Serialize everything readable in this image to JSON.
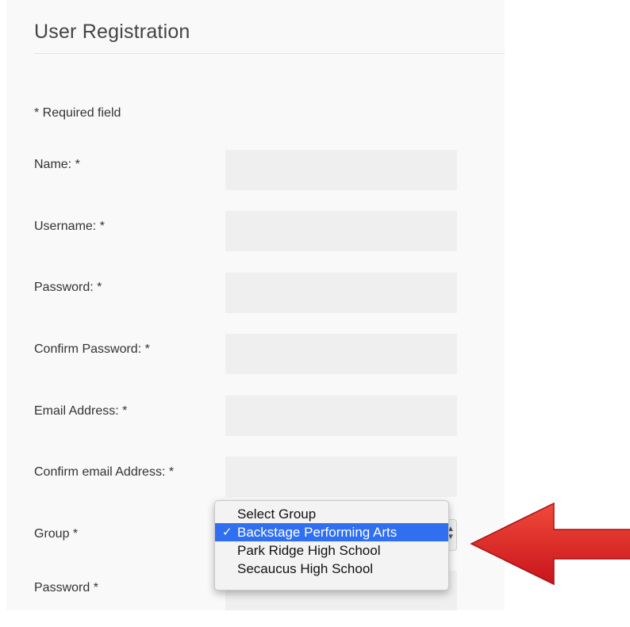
{
  "form": {
    "title": "User Registration",
    "required_note": "* Required field",
    "fields": [
      {
        "label": "Name: *",
        "value": ""
      },
      {
        "label": "Username: *",
        "value": ""
      },
      {
        "label": "Password: *",
        "value": ""
      },
      {
        "label": "Confirm Password: *",
        "value": ""
      },
      {
        "label": "Email Address: *",
        "value": ""
      },
      {
        "label": "Confirm email Address: *",
        "value": ""
      }
    ],
    "group_label": "Group *",
    "password2_label": "Password *"
  },
  "group_dropdown": {
    "options": [
      "Select Group",
      "Backstage Performing Arts",
      "Park Ridge High School",
      "Secaucus High School"
    ],
    "selected": "Backstage Performing Arts",
    "selected_color": "#2f6ff0"
  },
  "annotation": {
    "arrow_icon": "red-arrow-icon",
    "arrow_color": "#e8231f"
  }
}
